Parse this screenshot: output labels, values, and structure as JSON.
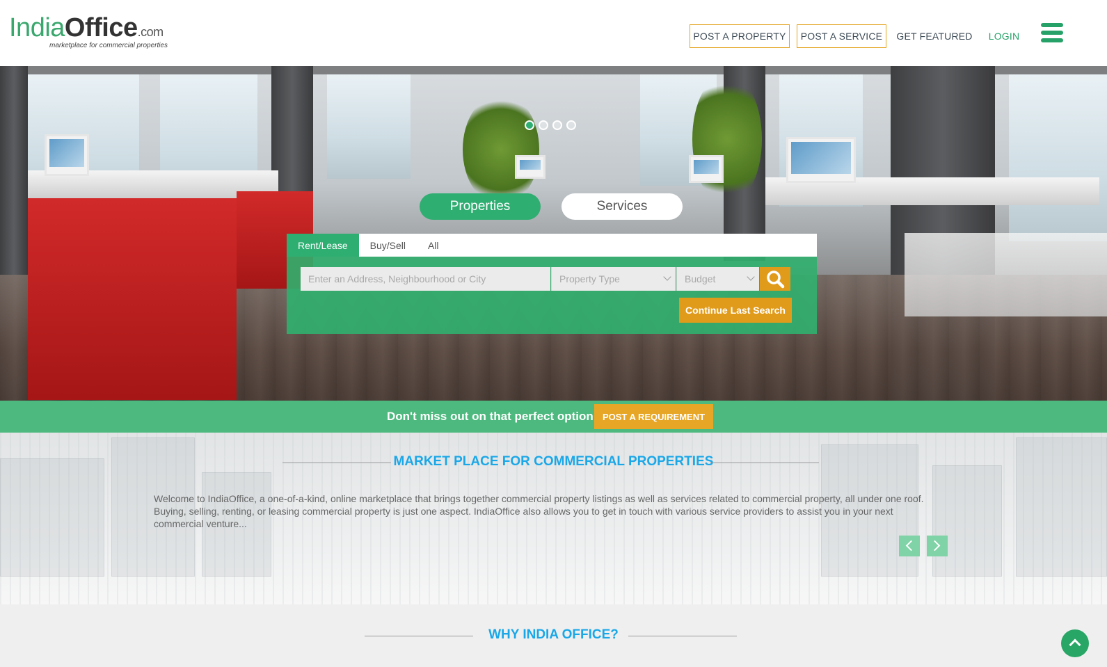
{
  "brand": {
    "logo_india": "India",
    "logo_office": "Office",
    "logo_com": ".com",
    "tagline": "marketplace for commercial properties",
    "accent_green": "#2fae72",
    "accent_orange": "#e19b1b"
  },
  "nav": {
    "post_property": "POST A PROPERTY",
    "post_service": "POST A SERVICE",
    "get_featured": "GET FEATURED",
    "login": "LOGIN",
    "menu_icon": "hamburger-menu-icon"
  },
  "hero": {
    "carousel": {
      "slides": 4,
      "active_index": 0
    },
    "toggle": {
      "properties": "Properties",
      "services": "Services",
      "selected": "Properties"
    },
    "tabs": [
      {
        "label": "Rent/Lease",
        "active": true
      },
      {
        "label": "Buy/Sell",
        "active": false
      },
      {
        "label": "All",
        "active": false
      }
    ],
    "search": {
      "address_placeholder": "Enter an Address, Neighbourhood or City",
      "property_type": "Property Type",
      "budget": "Budget",
      "search_icon": "search-icon",
      "continue_label": "Continue Last Search"
    }
  },
  "banner": {
    "text": "Don't miss out on that perfect option",
    "button": "POST A REQUIREMENT"
  },
  "market": {
    "title": "MARKET PLACE FOR COMMERCIAL PROPERTIES",
    "lines": [
      "Welcome to IndiaOffice, a one-of-a-kind, online marketplace that brings together commercial property listings as well as services related to commercial property, all under one roof.",
      "Buying, selling, renting, or leasing commercial property is just one aspect. IndiaOffice also allows you to get in touch with various service providers to assist you in your next",
      "commercial venture..."
    ]
  },
  "why": {
    "title": "WHY INDIA OFFICE?"
  }
}
